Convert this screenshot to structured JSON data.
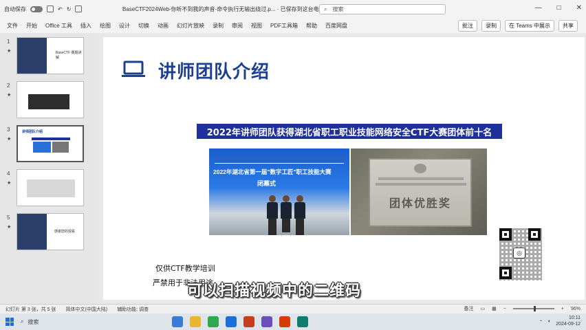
{
  "titlebar": {
    "autosave": "自动保存",
    "doc_title": "BaseCTF2024Web-你听不到我的声音-命令执行无输出绕过.p... · 已保存到这台电脑",
    "search_placeholder": "搜索",
    "controls": [
      "—",
      "□",
      "✕"
    ]
  },
  "ribbon": {
    "tabs": [
      "文件",
      "开始",
      "Office 工具",
      "插入",
      "绘图",
      "设计",
      "切换",
      "动画",
      "幻灯片放映",
      "录制",
      "审阅",
      "视图",
      "PDF工具箱",
      "帮助",
      "百度网盘"
    ],
    "comment_btn": "批注",
    "record_btn": "录制",
    "teams_btn": "在 Teams 中展示",
    "share_btn": "共享"
  },
  "thumbnails": [
    {
      "num": "1",
      "title": "BaseCTF 赛题讲解"
    },
    {
      "num": "2",
      "title": ""
    },
    {
      "num": "3",
      "title": "讲师团队介绍",
      "selected": true
    },
    {
      "num": "4",
      "title": ""
    },
    {
      "num": "5",
      "title": "感谢您的观看"
    }
  ],
  "slide": {
    "heading": "讲师团队介绍",
    "banner": "2022年讲师团队获得湖北省职工职业技能网络安全CTF大赛团体前十名",
    "photo_left_text": "2022年湖北省第一届\"数字工匠\"职工技能大赛",
    "photo_left_sub": "闭幕式",
    "photo_right_text": "团体优胜奖",
    "note1": "仅供CTF教学培训",
    "note2": "严禁用于非法用途"
  },
  "subtitle": "可以扫描视频中的二维码",
  "statusbar": {
    "slide_info": "幻灯片 第 3 张，共 5 张",
    "language": "简体中文(中国大陆)",
    "accessibility": "辅助功能: 调查",
    "notes": "备注",
    "zoom": "96%"
  },
  "taskbar": {
    "search": "搜索",
    "time": "10:11",
    "date": "2024-09-12"
  }
}
